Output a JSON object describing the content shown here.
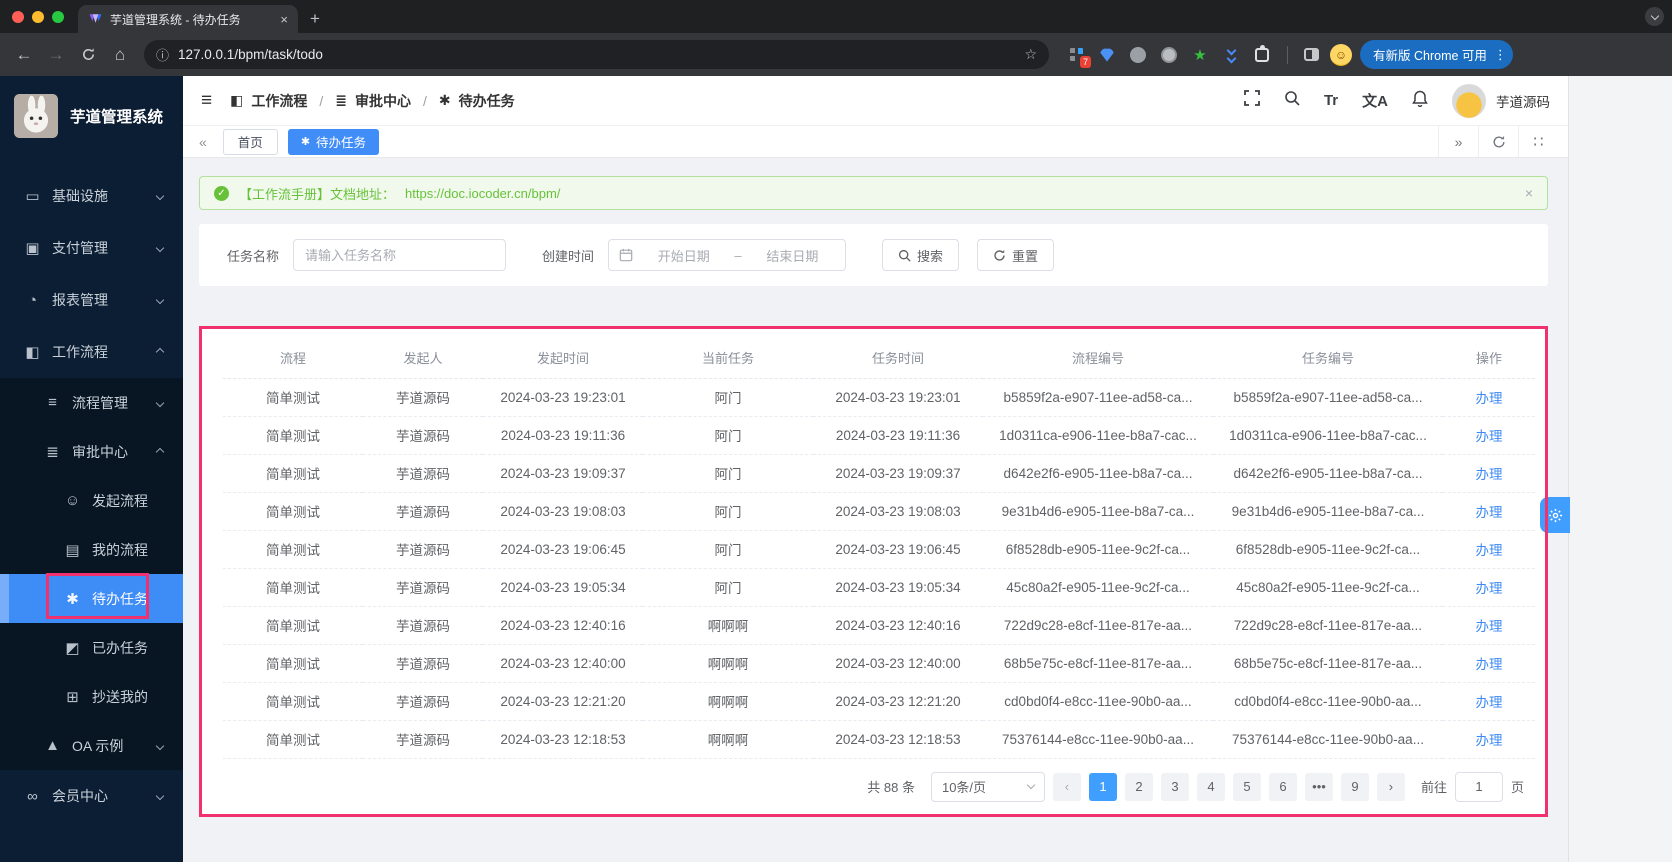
{
  "browser": {
    "tab_title": "芋道管理系统 - 待办任务",
    "close_tab": "×",
    "new_tab": "+",
    "url": "127.0.0.1/bpm/task/todo",
    "back": "←",
    "forward": "→",
    "home": "⌂",
    "info": "ⓘ",
    "star": "☆",
    "extension_badge": "7",
    "update_label": "有新版 Chrome 可用",
    "kebab": "⋮"
  },
  "sidebar": {
    "app_title": "芋道管理系统",
    "items": [
      {
        "label": "基础设施",
        "icon": "monitor-icon",
        "level": 1,
        "state": "collapsed"
      },
      {
        "label": "支付管理",
        "icon": "payment-icon",
        "level": 1,
        "state": "collapsed"
      },
      {
        "label": "报表管理",
        "icon": "chart-icon",
        "level": 1,
        "state": "collapsed"
      },
      {
        "label": "工作流程",
        "icon": "workflow-icon",
        "level": 1,
        "state": "expanded"
      },
      {
        "label": "流程管理",
        "icon": "process-icon",
        "level": 2,
        "state": "collapsed",
        "block": true
      },
      {
        "label": "审批中心",
        "icon": "approval-icon",
        "level": 2,
        "state": "expanded",
        "block": true
      },
      {
        "label": "发起流程",
        "icon": "smiley-icon",
        "level": 3,
        "block": true
      },
      {
        "label": "我的流程",
        "icon": "book-icon",
        "level": 3,
        "block": true
      },
      {
        "label": "待办任务",
        "icon": "task-icon",
        "level": 3,
        "block": true,
        "active": true,
        "annotated": true
      },
      {
        "label": "已办任务",
        "icon": "done-icon",
        "level": 3,
        "block": true
      },
      {
        "label": "抄送我的",
        "icon": "copy-icon",
        "level": 3,
        "block": true
      },
      {
        "label": "OA 示例",
        "icon": "oa-icon",
        "level": 2,
        "state": "collapsed",
        "block": true
      },
      {
        "label": "会员中心",
        "icon": "member-icon",
        "level": 1,
        "state": "collapsed"
      }
    ]
  },
  "header": {
    "breadcrumb": [
      {
        "label": "工作流程",
        "icon": "workflow-icon"
      },
      {
        "label": "审批中心",
        "icon": "approval-icon"
      },
      {
        "label": "待办任务",
        "icon": "task-icon"
      }
    ],
    "separator": "/",
    "font_tool": "Tr",
    "lang_tool": "文A",
    "username": "芋道源码"
  },
  "tabs": [
    {
      "label": "首页"
    },
    {
      "label": "待办任务",
      "active": true
    }
  ],
  "tabsbar": {
    "left_arrow": "«",
    "right_arrow": "»",
    "grid": "∷"
  },
  "banner": {
    "text": "【工作流手册】文档地址：",
    "link": "https://doc.iocoder.cn/bpm/",
    "close": "×"
  },
  "filter": {
    "task_name_label": "任务名称",
    "task_name_placeholder": "请输入任务名称",
    "create_time_label": "创建时间",
    "start_placeholder": "开始日期",
    "range_separator": "–",
    "end_placeholder": "结束日期",
    "search_label": "搜索",
    "reset_label": "重置"
  },
  "table": {
    "columns": [
      "流程",
      "发起人",
      "发起时间",
      "当前任务",
      "任务时间",
      "流程编号",
      "任务编号",
      "操作"
    ],
    "action_label": "办理",
    "rows": [
      {
        "process": "简单测试",
        "initiator": "芋道源码",
        "start_time": "2024-03-23 19:23:01",
        "current_task": "阿门",
        "task_time": "2024-03-23 19:23:01",
        "process_id": "b5859f2a-e907-11ee-ad58-ca...",
        "task_id": "b5859f2a-e907-11ee-ad58-ca..."
      },
      {
        "process": "简单测试",
        "initiator": "芋道源码",
        "start_time": "2024-03-23 19:11:36",
        "current_task": "阿门",
        "task_time": "2024-03-23 19:11:36",
        "process_id": "1d0311ca-e906-11ee-b8a7-cac...",
        "task_id": "1d0311ca-e906-11ee-b8a7-cac..."
      },
      {
        "process": "简单测试",
        "initiator": "芋道源码",
        "start_time": "2024-03-23 19:09:37",
        "current_task": "阿门",
        "task_time": "2024-03-23 19:09:37",
        "process_id": "d642e2f6-e905-11ee-b8a7-ca...",
        "task_id": "d642e2f6-e905-11ee-b8a7-ca..."
      },
      {
        "process": "简单测试",
        "initiator": "芋道源码",
        "start_time": "2024-03-23 19:08:03",
        "current_task": "阿门",
        "task_time": "2024-03-23 19:08:03",
        "process_id": "9e31b4d6-e905-11ee-b8a7-ca...",
        "task_id": "9e31b4d6-e905-11ee-b8a7-ca..."
      },
      {
        "process": "简单测试",
        "initiator": "芋道源码",
        "start_time": "2024-03-23 19:06:45",
        "current_task": "阿门",
        "task_time": "2024-03-23 19:06:45",
        "process_id": "6f8528db-e905-11ee-9c2f-ca...",
        "task_id": "6f8528db-e905-11ee-9c2f-ca..."
      },
      {
        "process": "简单测试",
        "initiator": "芋道源码",
        "start_time": "2024-03-23 19:05:34",
        "current_task": "阿门",
        "task_time": "2024-03-23 19:05:34",
        "process_id": "45c80a2f-e905-11ee-9c2f-ca...",
        "task_id": "45c80a2f-e905-11ee-9c2f-ca..."
      },
      {
        "process": "简单测试",
        "initiator": "芋道源码",
        "start_time": "2024-03-23 12:40:16",
        "current_task": "啊啊啊",
        "task_time": "2024-03-23 12:40:16",
        "process_id": "722d9c28-e8cf-11ee-817e-aa...",
        "task_id": "722d9c28-e8cf-11ee-817e-aa..."
      },
      {
        "process": "简单测试",
        "initiator": "芋道源码",
        "start_time": "2024-03-23 12:40:00",
        "current_task": "啊啊啊",
        "task_time": "2024-03-23 12:40:00",
        "process_id": "68b5e75c-e8cf-11ee-817e-aa...",
        "task_id": "68b5e75c-e8cf-11ee-817e-aa..."
      },
      {
        "process": "简单测试",
        "initiator": "芋道源码",
        "start_time": "2024-03-23 12:21:20",
        "current_task": "啊啊啊",
        "task_time": "2024-03-23 12:21:20",
        "process_id": "cd0bd0f4-e8cc-11ee-90b0-aa...",
        "task_id": "cd0bd0f4-e8cc-11ee-90b0-aa..."
      },
      {
        "process": "简单测试",
        "initiator": "芋道源码",
        "start_time": "2024-03-23 12:18:53",
        "current_task": "啊啊啊",
        "task_time": "2024-03-23 12:18:53",
        "process_id": "75376144-e8cc-11ee-90b0-aa...",
        "task_id": "75376144-e8cc-11ee-90b0-aa..."
      }
    ]
  },
  "pagination": {
    "total_text": "共 88 条",
    "page_size": "10条/页",
    "prev": "‹",
    "next": "›",
    "pages": [
      "1",
      "2",
      "3",
      "4",
      "5",
      "6",
      "•••",
      "9"
    ],
    "active_page": "1",
    "goto_label": "前往",
    "goto_value": "1",
    "page_unit": "页"
  },
  "colors": {
    "accent_blue": "#409eff",
    "annotation_pink": "#f0316d",
    "success_green": "#67c23a",
    "sidebar_navy": "#0c1e33",
    "chrome_pill_blue": "#1a6dc0"
  }
}
